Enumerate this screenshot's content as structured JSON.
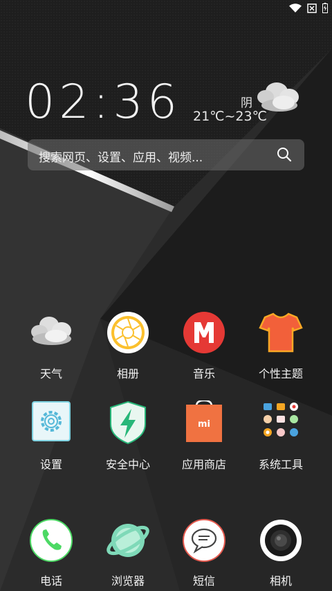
{
  "status_bar": {
    "icons": [
      "wifi-icon",
      "no-sim-icon",
      "battery-charging-icon"
    ]
  },
  "clock": {
    "time": "02:36"
  },
  "weather": {
    "condition": "阴",
    "temperature": "21℃~23℃",
    "icon": "cloudy-icon"
  },
  "search": {
    "placeholder": "搜索网页、设置、应用、视频...",
    "icon": "search-icon"
  },
  "apps": [
    {
      "label": "天气",
      "icon": "weather-app-icon"
    },
    {
      "label": "相册",
      "icon": "gallery-app-icon"
    },
    {
      "label": "音乐",
      "icon": "music-app-icon"
    },
    {
      "label": "个性主题",
      "icon": "themes-app-icon"
    },
    {
      "label": "设置",
      "icon": "settings-app-icon"
    },
    {
      "label": "安全中心",
      "icon": "security-app-icon"
    },
    {
      "label": "应用商店",
      "icon": "app-store-icon"
    },
    {
      "label": "系统工具",
      "icon": "system-tools-folder-icon"
    }
  ],
  "dock": [
    {
      "label": "电话",
      "icon": "phone-app-icon"
    },
    {
      "label": "浏览器",
      "icon": "browser-app-icon"
    },
    {
      "label": "短信",
      "icon": "messages-app-icon"
    },
    {
      "label": "相机",
      "icon": "camera-app-icon"
    }
  ],
  "colors": {
    "music_red": "#e53935",
    "theme_orange": "#f2603a",
    "store_orange": "#f07241",
    "security_green": "#28b779",
    "phone_green": "#4cd964"
  }
}
